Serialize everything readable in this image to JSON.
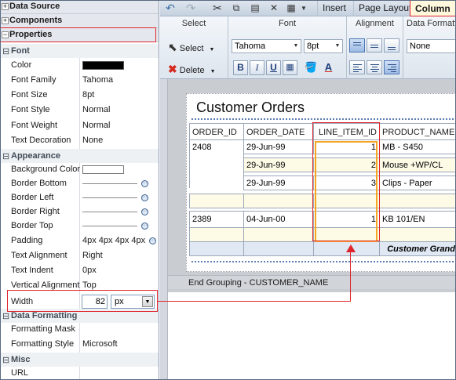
{
  "inspector": {
    "sections": {
      "data_source": "Data Source",
      "components": "Components",
      "properties": "Properties"
    },
    "categories": {
      "font": "Font",
      "appearance": "Appearance",
      "data_formatting": "Data Formatting",
      "misc": "Misc"
    },
    "props": {
      "color": {
        "label": "Color",
        "value": "#000000"
      },
      "font_family": {
        "label": "Font Family",
        "value": "Tahoma"
      },
      "font_size": {
        "label": "Font Size",
        "value": "8pt"
      },
      "font_style": {
        "label": "Font Style",
        "value": "Normal"
      },
      "font_weight": {
        "label": "Font Weight",
        "value": "Normal"
      },
      "text_decoration": {
        "label": "Text Decoration",
        "value": "None"
      },
      "background_color": {
        "label": "Background Color",
        "value": "#ffffff"
      },
      "border_bottom": {
        "label": "Border Bottom"
      },
      "border_left": {
        "label": "Border Left"
      },
      "border_right": {
        "label": "Border Right"
      },
      "border_top": {
        "label": "Border Top"
      },
      "padding": {
        "label": "Padding",
        "value": "4px 4px 4px 4px"
      },
      "text_alignment": {
        "label": "Text Alignment",
        "value": "Right"
      },
      "text_indent": {
        "label": "Text Indent",
        "value": "0px"
      },
      "vertical_alignment": {
        "label": "Vertical Alignment",
        "value": "Top"
      },
      "width": {
        "label": "Width",
        "value": "82",
        "unit": "px"
      },
      "formatting_mask": {
        "label": "Formatting Mask",
        "value": ""
      },
      "formatting_style": {
        "label": "Formatting Style",
        "value": "Microsoft"
      },
      "url": {
        "label": "URL",
        "value": ""
      }
    }
  },
  "toolbar": {
    "tabs": [
      "Insert",
      "Page Layout",
      "Column"
    ],
    "active_tab": "Column"
  },
  "ribbon": {
    "select_group": {
      "title": "Select",
      "select_label": "Select",
      "delete_label": "Delete"
    },
    "font_group": {
      "title": "Font",
      "family": "Tahoma",
      "size": "8pt",
      "bold": "B",
      "italic": "I",
      "underline": "U"
    },
    "alignment_group": {
      "title": "Alignment"
    },
    "data_format_group": {
      "title": "Data Formatting",
      "value": "None"
    }
  },
  "report": {
    "title": "Customer Orders",
    "columns": [
      "ORDER_ID",
      "ORDER_DATE",
      "LINE_ITEM_ID",
      "PRODUCT_NAME"
    ],
    "rows": [
      {
        "order_id": "2408",
        "order_date": "29-Jun-99",
        "line_item_id": "1",
        "product_name": "MB - S450"
      },
      {
        "order_id": "",
        "order_date": "29-Jun-99",
        "line_item_id": "2",
        "product_name": "Mouse +WP/CL"
      },
      {
        "order_id": "",
        "order_date": "29-Jun-99",
        "line_item_id": "3",
        "product_name": "Clips - Paper"
      },
      {
        "order_id": "2389",
        "order_date": "04-Jun-00",
        "line_item_id": "1",
        "product_name": "KB 101/EN"
      }
    ],
    "grand_total_label": "Customer Grand",
    "end_grouping": "End Grouping - CUSTOMER_NAME"
  },
  "colors": {
    "highlight_red": "#e0242b",
    "highlight_orange": "#f5a623"
  }
}
